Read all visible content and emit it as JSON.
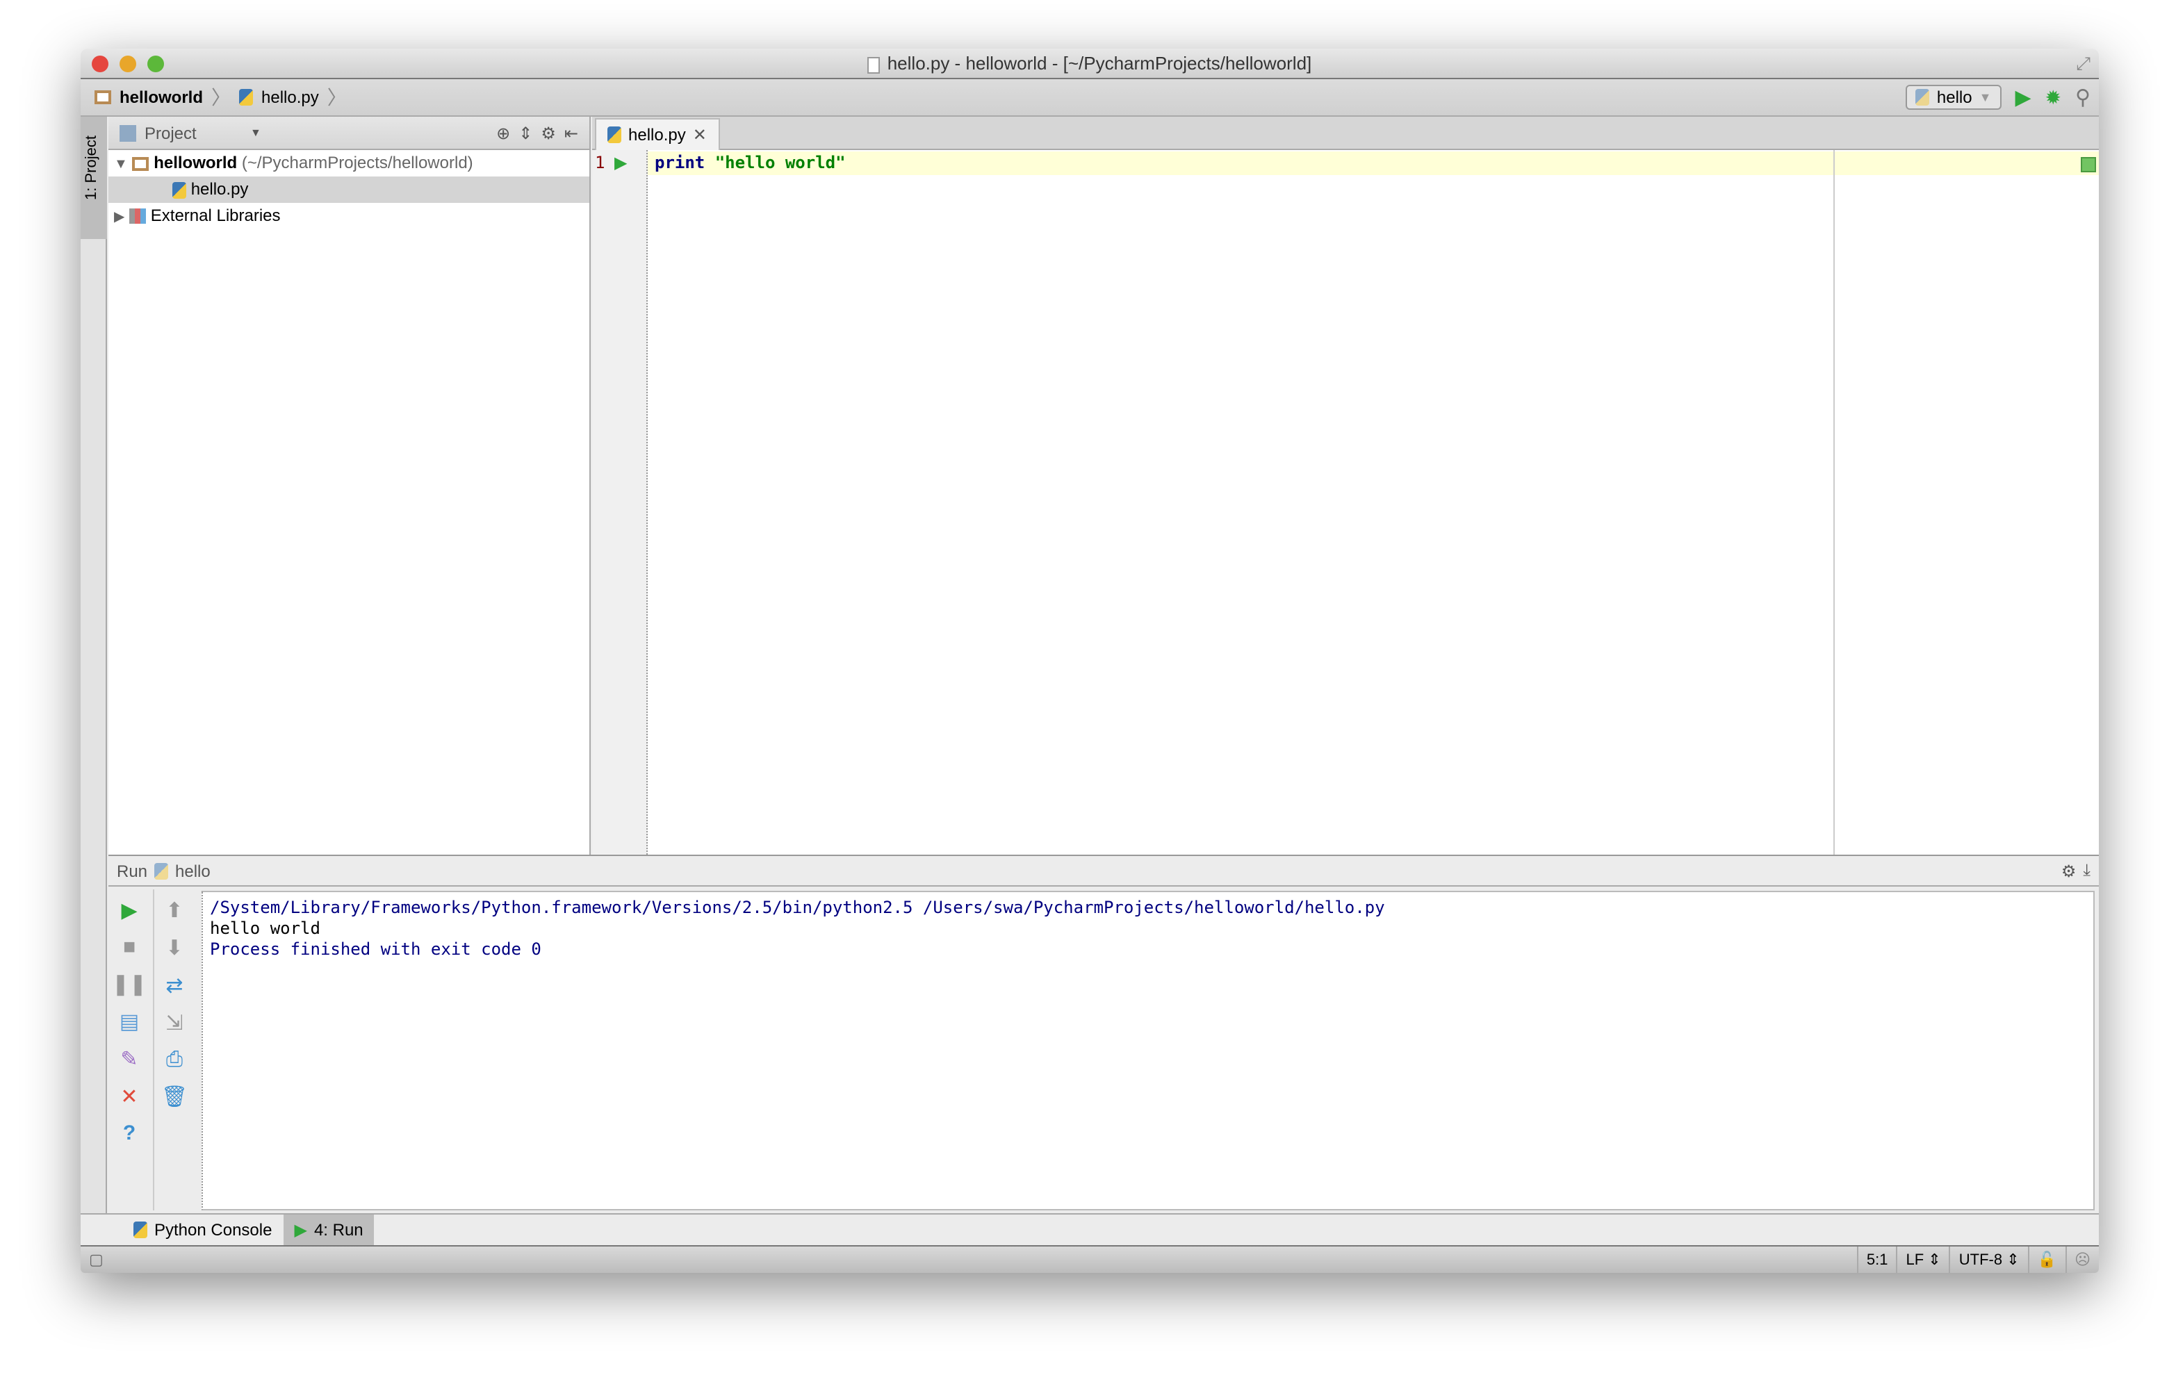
{
  "window": {
    "title": "hello.py - helloworld - [~/PycharmProjects/helloworld]"
  },
  "breadcrumb": [
    "helloworld",
    "hello.py"
  ],
  "toolbar": {
    "run_config": "hello"
  },
  "left_strip": {
    "tab": "1: Project"
  },
  "project": {
    "header": "Project",
    "tree": [
      {
        "label": "helloworld",
        "path": "(~/PycharmProjects/helloworld)"
      },
      {
        "label": "hello.py"
      },
      {
        "label": "External Libraries"
      }
    ]
  },
  "editor": {
    "tab": "hello.py",
    "line_number": "1",
    "code_keyword": "print",
    "code_string": " \"hello world\""
  },
  "run": {
    "label": "Run",
    "config": "hello",
    "output": [
      "/System/Library/Frameworks/Python.framework/Versions/2.5/bin/python2.5 /Users/swa/PycharmProjects/helloworld/hello.py",
      "hello world",
      "",
      "Process finished with exit code 0"
    ]
  },
  "bottom_tabs": [
    "Python Console",
    "4: Run"
  ],
  "status": {
    "position": "5:1",
    "line_sep": "LF",
    "encoding": "UTF-8"
  },
  "colors": {
    "run_green": "#2fa83a",
    "keyword": "#000080",
    "string": "#008000",
    "current_line": "#ffffd7"
  }
}
